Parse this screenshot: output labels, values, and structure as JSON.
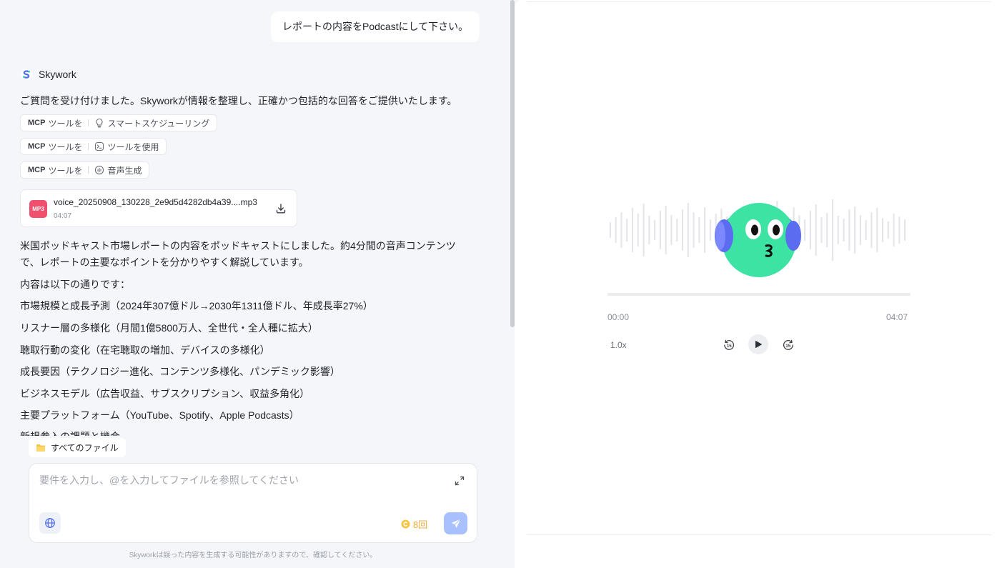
{
  "chat": {
    "user_message": "レポートの内容をPodcastにして下さい。",
    "bot_name": "Skywork",
    "intro": "ご質問を受け付けました。Skyworkが情報を整理し、正確かつ包括的な回答をご提供いたします。",
    "tools": [
      {
        "prefix": "MCP",
        "label_a": "ツールを",
        "label_b": "スマートスケジューリング",
        "icon": "lightbulb-icon"
      },
      {
        "prefix": "MCP",
        "label_a": "ツールを",
        "label_b": "ツールを使用",
        "icon": "terminal-icon"
      },
      {
        "prefix": "MCP",
        "label_a": "ツールを",
        "label_b": "音声生成",
        "icon": "audio-icon"
      }
    ],
    "file": {
      "badge": "MP3",
      "name": "voice_20250908_130228_2e9d5d4282db4a39....mp3",
      "duration": "04:07"
    },
    "paragraph_1": "米国ポッドキャスト市場レポートの内容をポッドキャストにしました。約4分間の音声コンテンツ",
    "paragraph_1b": "で、レポートの主要なポイントを分かりやすく解説しています。",
    "list_intro": "内容は以下の通りです：",
    "items": [
      "市場規模と成長予測（2024年307億ドル→2030年1311億ドル、年成長率27%）",
      "リスナー層の多様化（月間1億5800万人、全世代・全人種に拡大）",
      "聴取行動の変化（在宅聴取の増加、デバイスの多様化）",
      "成長要因（テクノロジー進化、コンテンツ多様化、パンデミック影響）",
      "ビジネスモデル（広告収益、サブスクリプション、収益多角化）",
      "主要プラットフォーム（YouTube、Spotify、Apple Podcasts）",
      "新規参入の課題と機会"
    ]
  },
  "composer": {
    "files_chip": "すべてのファイル",
    "placeholder": "要件を入力し、@を入力してファイルを参照してください",
    "credits": "8回",
    "disclaimer": "Skyworkは誤った内容を生成する可能性がありますので、確認してください。"
  },
  "player": {
    "time_current": "00:00",
    "time_total": "04:07",
    "progress": 0,
    "speed": "1.0x",
    "skip_back_seconds": "15",
    "skip_forward_seconds": "15"
  },
  "colors": {
    "accent": "#6b7cff",
    "send_button": "#a9c0ff",
    "mp3_badge": "#f0506e",
    "mascot_face": "#3de3a3",
    "headphones": "#5b6cf0",
    "credit": "#f0a83c"
  }
}
